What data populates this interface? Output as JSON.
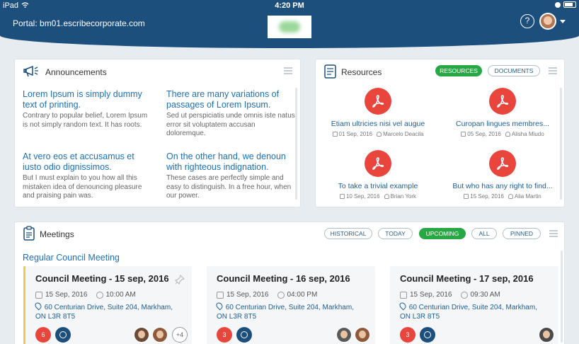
{
  "status_bar": {
    "device": "iPad",
    "time": "4:20 PM"
  },
  "header": {
    "portal": "Portal: bm01.escribecorporate.com",
    "help": "?"
  },
  "announcements": {
    "title": "Announcements",
    "items": [
      {
        "heading": "Lorem Ipsum is simply dummy text of printing.",
        "body": "Contrary to popular belief, Lorem Ipsum is not simply random text. It has roots."
      },
      {
        "heading": "There are many variations of passages of Lorem Ipsum.",
        "body": "Sed ut perspiciatis unde omnis iste natus error sit voluptatem accusan doloremque."
      },
      {
        "heading": "At vero eos et accusamus et iusto odio dignissimos.",
        "body": "But I must explain to you how all this mistaken idea of denouncing pleasure and praising pain was."
      },
      {
        "heading": "On the other hand, we denoun with righteous indignation.",
        "body": "These cases are perfectly simple and easy to distinguish. In a free hour, when our power."
      }
    ]
  },
  "resources": {
    "title": "Resources",
    "tabs": [
      {
        "label": "RESOURCES",
        "active": true
      },
      {
        "label": "DOCUMENTS",
        "active": false
      }
    ],
    "items": [
      {
        "name": "Etiam ultricies nisi vel augue",
        "date": "01 Sep, 2016",
        "author": "Marcelo Deacila"
      },
      {
        "name": "Curopan lingues membres...",
        "date": "05 Sep, 2016",
        "author": "Alisha Miudo"
      },
      {
        "name": "To take a trivial example",
        "date": "10 Sep, 2016",
        "author": "Brian York"
      },
      {
        "name": "But who has any right to find...",
        "date": "15 Sep, 2016",
        "author": "Alia Martin"
      }
    ]
  },
  "meetings": {
    "title": "Meetings",
    "filters": [
      {
        "label": "HISTORICAL",
        "active": false
      },
      {
        "label": "TODAY",
        "active": false
      },
      {
        "label": "UPCOMING",
        "active": true
      },
      {
        "label": "ALL",
        "active": false
      },
      {
        "label": "PINNED",
        "active": false
      }
    ],
    "group": "Regular Council Meeting",
    "cards": [
      {
        "title": "Council Meeting - 15 sep, 2016",
        "date": "15 Sep, 2016",
        "time": "10:00 AM",
        "address": "60 Centurian Drive, Suite 204, Markham, ON L3R 8T5",
        "count": "6",
        "more": "+4"
      },
      {
        "title": "Council Meeting - 16 sep, 2016",
        "date": "15 Sep, 2016",
        "time": "04:00 PM",
        "address": "60 Centurian Drive, Suite 204, Markham, ON L3R 8T5",
        "count": "3"
      },
      {
        "title": "Council Meeting - 17 sep, 2016",
        "date": "15 Sep, 2016",
        "time": "09:30 AM",
        "address": "60 Centurian Drive, Suite 204, Markham, ON L3R 8T5",
        "count": "3"
      }
    ]
  },
  "colors": {
    "primary": "#1d4f7c",
    "accent_green": "#27a844",
    "pdf_red": "#e8453c",
    "link_blue": "#1f6fb0"
  }
}
